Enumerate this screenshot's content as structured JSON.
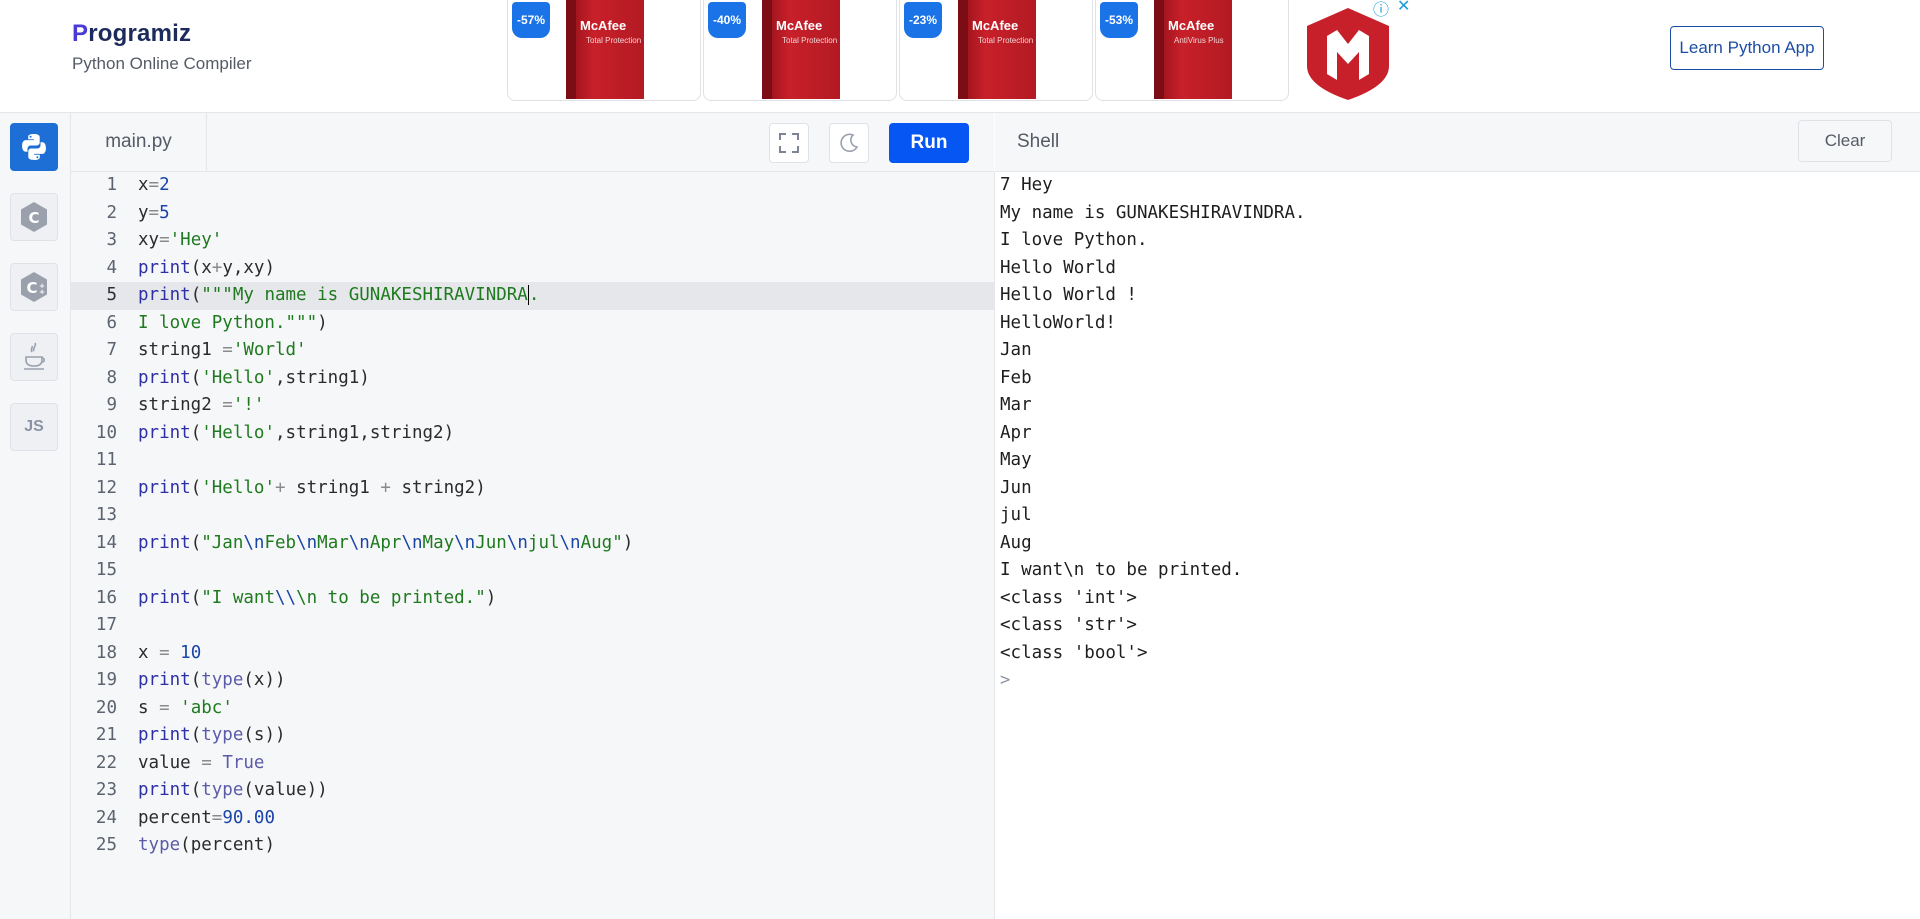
{
  "header": {
    "brand": "rogramiz",
    "brand_initial": "P",
    "subtitle": "Python Online Compiler",
    "learn_button": "Learn Python App"
  },
  "ads": {
    "items": [
      {
        "discount": "-57%",
        "product": "McAfee",
        "caption": "Total Protection"
      },
      {
        "discount": "-40%",
        "product": "McAfee",
        "caption": "Total Protection"
      },
      {
        "discount": "-23%",
        "product": "McAfee",
        "caption": "Total Protection"
      },
      {
        "discount": "-53%",
        "product": "McAfee",
        "caption": "AntiVirus Plus"
      }
    ],
    "info_icon": "info-icon",
    "close_icon": "close-icon"
  },
  "sidebar": {
    "items": [
      {
        "name": "python",
        "icon": "python-icon",
        "active": true
      },
      {
        "name": "c",
        "icon": "c-icon"
      },
      {
        "name": "cpp",
        "icon": "cpp-icon"
      },
      {
        "name": "java",
        "icon": "java-icon"
      },
      {
        "name": "js",
        "label": "JS"
      }
    ]
  },
  "editor": {
    "file_name": "main.py",
    "run_label": "Run",
    "current_line": 5,
    "lines": [
      "x=2",
      "y=5",
      "xy='Hey'",
      "print(x+y,xy)",
      "print(\"\"\"My name is GUNAKESHIRAVINDRA.",
      "I love Python.\"\"\")",
      "string1 ='World'",
      "print('Hello',string1)",
      "string2 ='!'",
      "print('Hello',string1,string2)",
      "",
      "print('Hello'+ string1 + string2)",
      "",
      "print(\"Jan\\nFeb\\nMar\\nApr\\nMay\\nJun\\njul\\nAug\")",
      "",
      "print(\"I want\\\\n to be printed.\")",
      "",
      "x = 10",
      "print(type(x))",
      "s = 'abc'",
      "print(type(s))",
      "value = True",
      "print(type(value))",
      "percent=90.00",
      "type(percent)"
    ]
  },
  "shell": {
    "title": "Shell",
    "clear_label": "Clear",
    "prompt": ">",
    "output": [
      "7 Hey",
      "My name is GUNAKESHIRAVINDRA.",
      "I love Python.",
      "Hello World",
      "Hello World !",
      "HelloWorld!",
      "Jan",
      "Feb",
      "Mar",
      "Apr",
      "May",
      "Jun",
      "jul",
      "Aug",
      "I want\\n to be printed.",
      "<class 'int'>",
      "<class 'str'>",
      "<class 'bool'>"
    ]
  },
  "colors": {
    "run_button": "#0556f3",
    "keyword": "#2c2fa6",
    "string": "#1f7a1f",
    "number": "#1a44a8",
    "sidebar_active": "#1d6fd6"
  }
}
